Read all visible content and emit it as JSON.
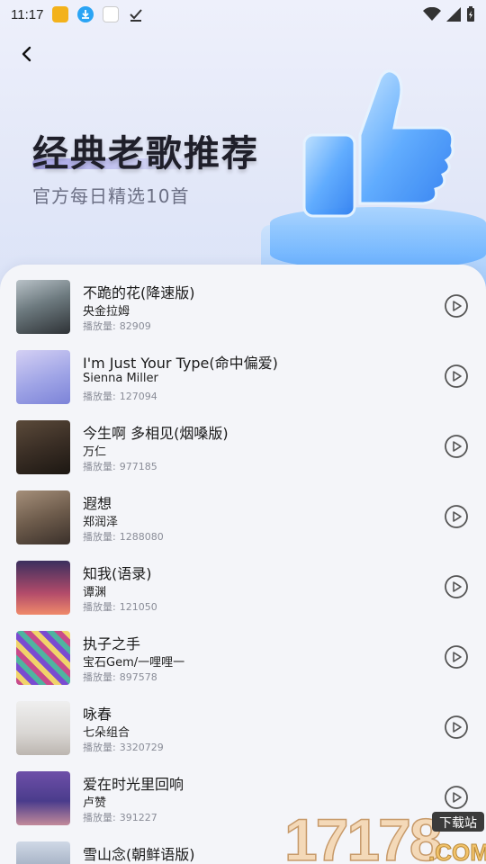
{
  "status": {
    "time": "11:17"
  },
  "hero": {
    "title": "经典老歌推荐",
    "subtitle": "官方每日精选10首"
  },
  "plays_label": "播放量:",
  "songs": [
    {
      "title": "不跪的花(降速版)",
      "artist": "央金拉姆",
      "plays": "82909"
    },
    {
      "title": "I'm Just Your Type(命中偏爱)",
      "artist": "Sienna Miller",
      "plays": "127094"
    },
    {
      "title": "今生啊 多相见(烟嗓版)",
      "artist": "万仁",
      "plays": "977185"
    },
    {
      "title": "遐想",
      "artist": "郑润泽",
      "plays": "1288080"
    },
    {
      "title": "知我(语录)",
      "artist": "谭渊",
      "plays": "121050"
    },
    {
      "title": "执子之手",
      "artist": "宝石Gem/一哩哩一",
      "plays": "897578"
    },
    {
      "title": "咏春",
      "artist": "七朵组合",
      "plays": "3320729"
    },
    {
      "title": "爱在时光里回响",
      "artist": "卢赞",
      "plays": "391227"
    },
    {
      "title": "雪山念(朝鲜语版)",
      "artist": "",
      "plays": ""
    }
  ],
  "watermark": {
    "number": "17178",
    "tag": "下载站",
    "suffix": ".COM"
  },
  "colors": {
    "accent": "#5aa9ff",
    "text": "#1a1a1a",
    "muted": "#8a8d98"
  }
}
